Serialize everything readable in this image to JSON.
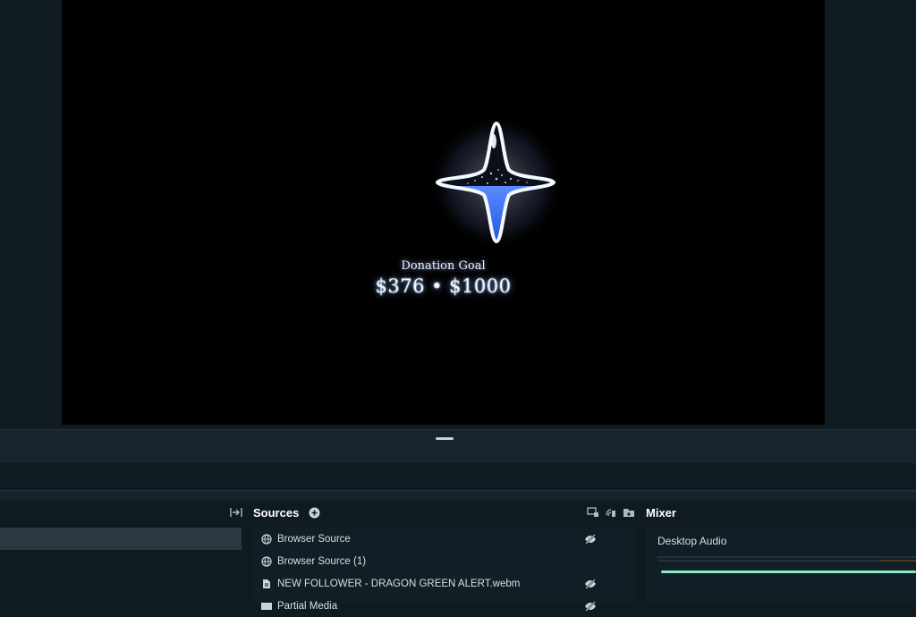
{
  "preview": {
    "widget": {
      "title": "Donation Goal",
      "amount": "$376 • $1000",
      "progress": 0.376,
      "accent": "#2f6bff"
    }
  },
  "dock": {
    "sources": {
      "title": "Sources",
      "items": [
        {
          "label": "Browser Source",
          "icon": "globe-icon",
          "hidden": true
        },
        {
          "label": "Browser Source (1)",
          "icon": "globe-icon",
          "hidden": false
        },
        {
          "label": "NEW FOLLOWER - DRAGON GREEN ALERT.webm",
          "icon": "file-icon",
          "hidden": true
        },
        {
          "label": "Partial Media",
          "icon": "video-icon",
          "hidden": true
        }
      ]
    },
    "mixer": {
      "title": "Mixer",
      "channels": [
        {
          "label": "Desktop Audio",
          "volume": 1.0
        }
      ]
    },
    "colors": {
      "accent": "#8ee9c7",
      "panel": "#121e26",
      "background": "#0f1a21"
    }
  }
}
